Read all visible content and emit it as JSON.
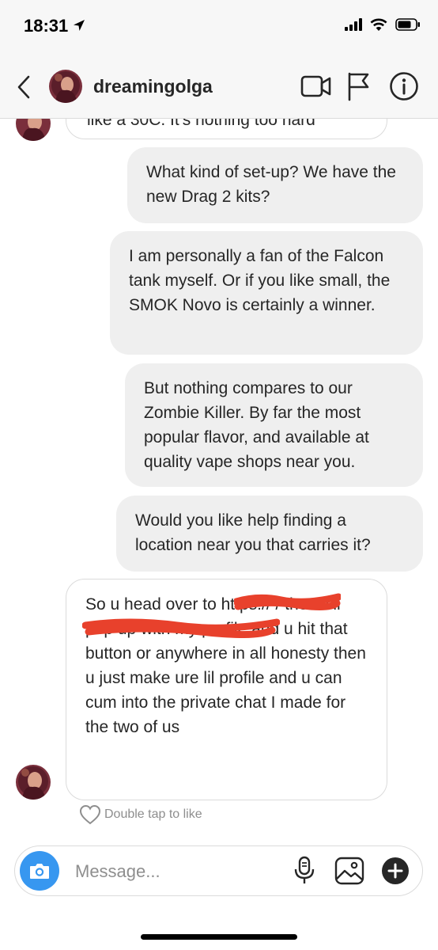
{
  "status_bar": {
    "time": "18:31",
    "location_icon": "location-arrow-icon",
    "signal_icon": "cellular-signal-icon",
    "wifi_icon": "wifi-icon",
    "battery_icon": "battery-icon"
  },
  "header": {
    "username": "dreamingolga",
    "back_icon": "chevron-left-icon",
    "video_icon": "video-camera-icon",
    "flag_icon": "flag-icon",
    "info_icon": "info-icon"
  },
  "messages": [
    {
      "direction": "incoming",
      "text": "like a 30C. It's nothing too hard"
    },
    {
      "direction": "outgoing",
      "text": "What kind of set-up? We have the new Drag 2 kits?"
    },
    {
      "direction": "outgoing",
      "text": "I am personally a fan of the Falcon tank myself. Or if you like small, the SMOK Novo is certainly a winner."
    },
    {
      "direction": "outgoing",
      "text": "But nothing compares to our Zombie Killer. By far the most popular flavor, and available at quality vape shops near you."
    },
    {
      "direction": "outgoing",
      "text": "Would you like help finding a location near you that carries it?"
    },
    {
      "direction": "incoming",
      "text": "So u head over to https://               / then it'll pop up with my profile and u hit that button or anywhere in all honesty then u just make ure lil profile and u can cum into the private chat I made for the two of us"
    }
  ],
  "like_hint": "Double tap to like",
  "composer": {
    "placeholder": "Message...",
    "camera_icon": "camera-icon",
    "mic_icon": "microphone-icon",
    "gallery_icon": "image-gallery-icon",
    "add_icon": "plus-circle-icon"
  },
  "colors": {
    "accent": "#3797f0",
    "outgoing_bubble": "#efefef",
    "incoming_border": "#dbdbdb",
    "redaction": "#e8412c"
  }
}
